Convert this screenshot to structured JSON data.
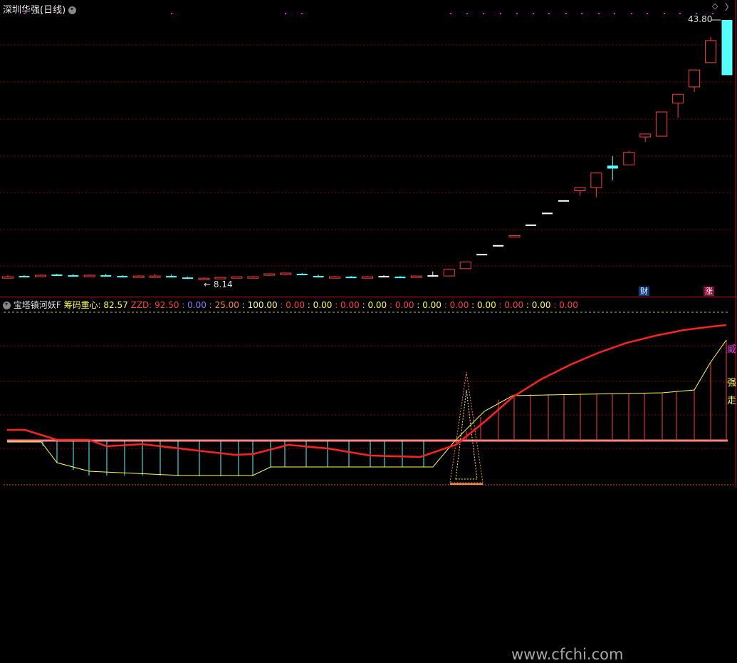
{
  "stock": {
    "title": "深圳华强(日线)"
  },
  "price_labels": {
    "high": "43.80",
    "low": "8.14"
  },
  "events": {
    "finance": "财",
    "limit_up": "涨"
  },
  "indicator": {
    "name": "宝塔镇河妖F",
    "values": [
      {
        "text": "筹码重心: 82.57",
        "color": "#ffff40"
      },
      {
        "text": "ZZD: 92.50",
        "color": "#ff4040"
      },
      {
        "text": ": 0.00",
        "color": "#8080ff"
      },
      {
        "text": ": 25.00",
        "color": "#ff8040"
      },
      {
        "text": ": 100.00",
        "color": "#ffff80"
      },
      {
        "text": ": 0.00",
        "color": "#ff4040"
      },
      {
        "text": ": 0.00",
        "color": "#ffff40"
      },
      {
        "text": ": 0.00",
        "color": "#ff4040"
      },
      {
        "text": ": 0.00",
        "color": "#ffff40"
      },
      {
        "text": ": 0.00",
        "color": "#ff4040"
      },
      {
        "text": ": 0.00",
        "color": "#ffff40"
      },
      {
        "text": ": 0.00",
        "color": "#ff4040"
      },
      {
        "text": ": 0.00",
        "color": "#ffff40"
      },
      {
        "text": ": 0.00",
        "color": "#ff4040"
      },
      {
        "text": ": 0.00",
        "color": "#ffff40"
      },
      {
        "text": ": 0.00",
        "color": "#ff4040"
      }
    ],
    "side_labels": {
      "top": "威",
      "mid": "强",
      "bot": "走"
    }
  },
  "watermark": "www.cfchi.com",
  "colors": {
    "up": "#ff3c3c",
    "down": "#54ffff",
    "grid": "#8b0000",
    "accent": "#ff00ff",
    "main_line": "#ff2020",
    "yellow": "#ffff40"
  },
  "chart_data": {
    "type": "candlestick",
    "ylim": [
      8.14,
      43.8
    ],
    "candles": [
      {
        "o": 8.9,
        "h": 9.1,
        "l": 8.8,
        "c": 8.8,
        "dir": "up"
      },
      {
        "o": 9.0,
        "h": 9.1,
        "l": 8.9,
        "c": 9.0,
        "dir": "down"
      },
      {
        "o": 9.1,
        "h": 9.2,
        "l": 9.0,
        "c": 9.1,
        "dir": "up"
      },
      {
        "o": 9.1,
        "h": 9.3,
        "l": 9.0,
        "c": 9.2,
        "dir": "down"
      },
      {
        "o": 9.1,
        "h": 9.3,
        "l": 9.0,
        "c": 9.1,
        "dir": "down"
      },
      {
        "o": 9.1,
        "h": 9.2,
        "l": 9.0,
        "c": 9.1,
        "dir": "up"
      },
      {
        "o": 9.1,
        "h": 9.3,
        "l": 9.0,
        "c": 9.0,
        "dir": "down"
      },
      {
        "o": 9.0,
        "h": 9.1,
        "l": 8.8,
        "c": 8.9,
        "dir": "down"
      },
      {
        "o": 8.9,
        "h": 9.1,
        "l": 8.8,
        "c": 9.0,
        "dir": "up"
      },
      {
        "o": 9.0,
        "h": 9.3,
        "l": 8.9,
        "c": 9.0,
        "dir": "up"
      },
      {
        "o": 9.0,
        "h": 9.2,
        "l": 8.8,
        "c": 8.8,
        "dir": "down"
      },
      {
        "o": 8.8,
        "h": 8.9,
        "l": 8.6,
        "c": 8.7,
        "dir": "down"
      },
      {
        "o": 8.7,
        "h": 8.8,
        "l": 8.5,
        "c": 8.7,
        "dir": "up"
      },
      {
        "o": 8.7,
        "h": 8.8,
        "l": 8.6,
        "c": 8.8,
        "dir": "up"
      },
      {
        "o": 8.8,
        "h": 8.9,
        "l": 8.7,
        "c": 8.9,
        "dir": "up"
      },
      {
        "o": 8.9,
        "h": 9.0,
        "l": 8.8,
        "c": 8.9,
        "dir": "up"
      },
      {
        "o": 9.1,
        "h": 9.3,
        "l": 9.0,
        "c": 9.3,
        "dir": "up"
      },
      {
        "o": 9.2,
        "h": 9.4,
        "l": 9.1,
        "c": 9.4,
        "dir": "up"
      },
      {
        "o": 9.3,
        "h": 9.4,
        "l": 9.1,
        "c": 9.2,
        "dir": "down"
      },
      {
        "o": 9.0,
        "h": 9.2,
        "l": 8.9,
        "c": 8.9,
        "dir": "down"
      },
      {
        "o": 8.9,
        "h": 9.0,
        "l": 8.8,
        "c": 8.9,
        "dir": "up"
      },
      {
        "o": 8.9,
        "h": 9.0,
        "l": 8.8,
        "c": 8.9,
        "dir": "down"
      },
      {
        "o": 8.9,
        "h": 9.0,
        "l": 8.8,
        "c": 8.9,
        "dir": "up"
      },
      {
        "o": 9.0,
        "h": 9.1,
        "l": 8.8,
        "c": 9.0,
        "dir": "flat"
      },
      {
        "o": 8.9,
        "h": 9.0,
        "l": 8.8,
        "c": 8.9,
        "dir": "down"
      },
      {
        "o": 8.9,
        "h": 9.0,
        "l": 8.8,
        "c": 9.0,
        "dir": "up"
      },
      {
        "o": 9.0,
        "h": 9.6,
        "l": 8.9,
        "c": 9.1,
        "dir": "flat"
      },
      {
        "o": 9.0,
        "h": 10.0,
        "l": 8.9,
        "c": 9.9,
        "dir": "up"
      },
      {
        "o": 10.0,
        "h": 10.9,
        "l": 10.0,
        "c": 10.9,
        "dir": "up"
      },
      {
        "o": 12.0,
        "h": 12.0,
        "l": 12.0,
        "c": 12.0,
        "dir": "flat"
      },
      {
        "o": 13.2,
        "h": 13.2,
        "l": 13.2,
        "c": 13.2,
        "dir": "flat"
      },
      {
        "o": 14.5,
        "h": 14.5,
        "l": 14.5,
        "c": 14.5,
        "dir": "up"
      },
      {
        "o": 16.0,
        "h": 16.0,
        "l": 16.0,
        "c": 16.0,
        "dir": "flat"
      },
      {
        "o": 17.6,
        "h": 17.6,
        "l": 17.6,
        "c": 17.6,
        "dir": "flat"
      },
      {
        "o": 19.3,
        "h": 19.3,
        "l": 19.3,
        "c": 19.3,
        "dir": "flat"
      },
      {
        "o": 20.6,
        "h": 21.0,
        "l": 19.9,
        "c": 21.0,
        "dir": "up"
      },
      {
        "o": 21.0,
        "h": 23.1,
        "l": 19.7,
        "c": 23.0,
        "dir": "up"
      },
      {
        "o": 24.0,
        "h": 25.3,
        "l": 22.0,
        "c": 23.6,
        "dir": "down"
      },
      {
        "o": 24.1,
        "h": 26.0,
        "l": 24.1,
        "c": 25.8,
        "dir": "up"
      },
      {
        "o": 27.9,
        "h": 28.3,
        "l": 27.2,
        "c": 28.3,
        "dir": "up"
      },
      {
        "o": 28.0,
        "h": 31.3,
        "l": 28.0,
        "c": 31.3,
        "dir": "up"
      },
      {
        "o": 32.5,
        "h": 33.7,
        "l": 30.5,
        "c": 33.7,
        "dir": "up"
      },
      {
        "o": 34.7,
        "h": 37.0,
        "l": 34.0,
        "c": 37.0,
        "dir": "up"
      },
      {
        "o": 38.0,
        "h": 41.5,
        "l": 38.0,
        "c": 41.0,
        "dir": "up"
      },
      {
        "o": 43.8,
        "h": 43.8,
        "l": 36.3,
        "c": 36.3,
        "dir": "down"
      }
    ]
  }
}
